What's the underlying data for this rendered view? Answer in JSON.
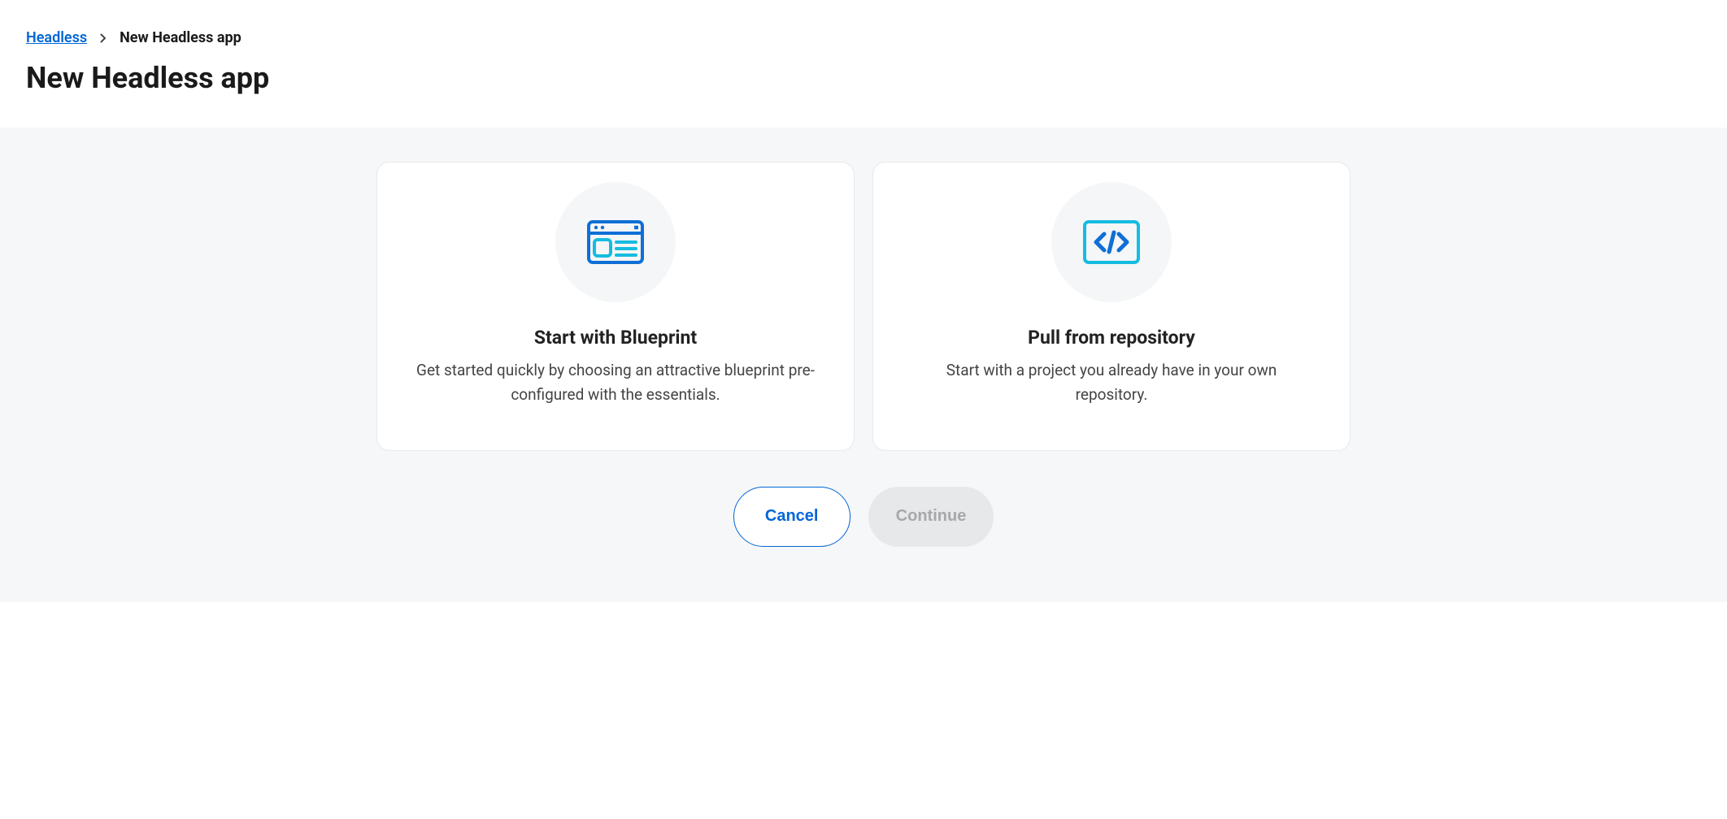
{
  "breadcrumb": {
    "parent": "Headless",
    "current": "New Headless app"
  },
  "page": {
    "title": "New Headless app"
  },
  "cards": [
    {
      "title": "Start with Blueprint",
      "description": "Get started quickly by choosing an attractive blueprint pre-configured with the essentials."
    },
    {
      "title": "Pull from repository",
      "description": "Start with a project you already have in your own repository."
    }
  ],
  "actions": {
    "cancel": "Cancel",
    "continue": "Continue"
  }
}
